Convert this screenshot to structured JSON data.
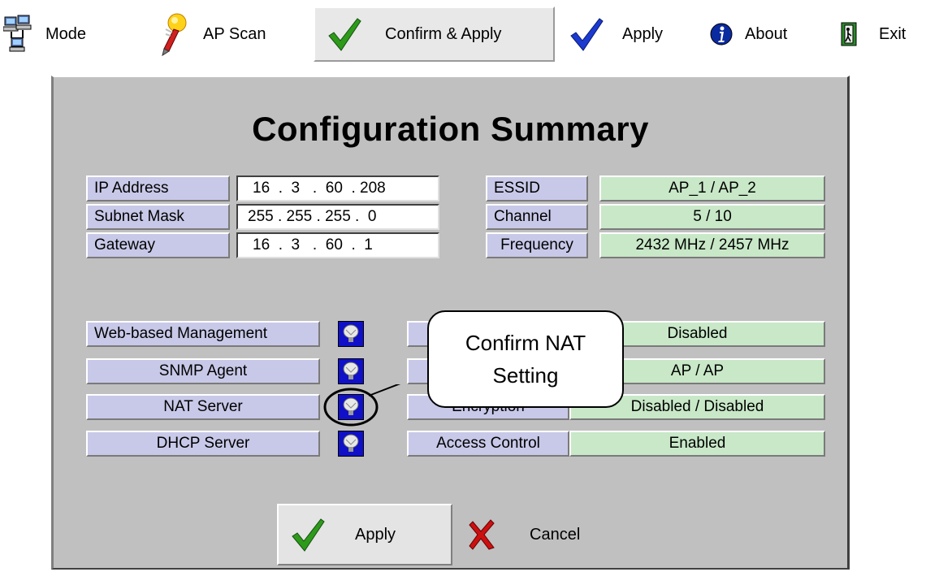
{
  "toolbar": {
    "mode_label": "Mode",
    "apscan_label": "AP Scan",
    "confirm_apply_label": "Confirm & Apply",
    "apply_label": "Apply",
    "about_label": "About",
    "exit_label": "Exit"
  },
  "summary": {
    "title": "Configuration Summary",
    "ip_label": "IP Address",
    "ip_value": "16  .  3   .  60  . 208",
    "subnet_label": "Subnet Mask",
    "subnet_value": "255 . 255 . 255 .  0",
    "gateway_label": "Gateway",
    "gateway_value": "16  .  3   .  60  .  1",
    "essid_label": "ESSID",
    "essid_value": "AP_1 / AP_2",
    "channel_label": "Channel",
    "channel_value": "5 / 10",
    "frequency_label": "Frequency",
    "frequency_value": "2432 MHz / 2457 MHz",
    "web_label": "Web-based Management",
    "snmp_label": "SNMP Agent",
    "nat_label": "NAT Server",
    "dhcp_label": "DHCP Server",
    "encryption_label": "Encryption",
    "access_label": "Access Control",
    "row1_value": "Disabled",
    "row2_value": "AP / AP",
    "encryption_value": "Disabled / Disabled",
    "access_value": "Enabled"
  },
  "callout": {
    "line1": "Confirm NAT",
    "line2": "Setting"
  },
  "buttons": {
    "apply": "Apply",
    "cancel": "Cancel"
  },
  "colors": {
    "label_bg": "#c8c8e8",
    "value_bg": "#c8e8c8",
    "window_bg": "#c0c0c0",
    "bulb_bg": "#1010c8",
    "check_green": "#2e9a1a",
    "check_blue": "#1a3ad0",
    "cancel_red": "#cc1010"
  }
}
